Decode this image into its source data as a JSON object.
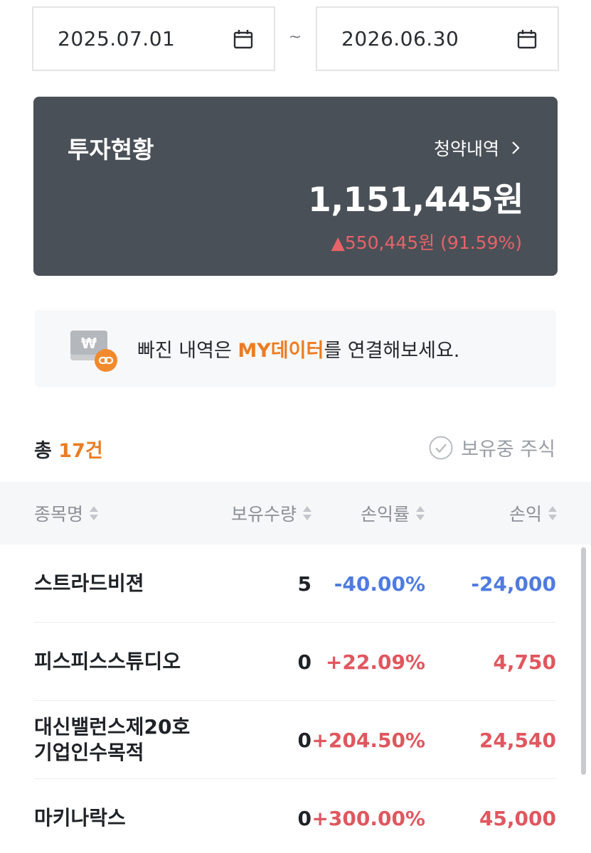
{
  "date_range": {
    "start": "2025.07.01",
    "separator": "~",
    "end": "2026.06.30",
    "icon": "calendar-icon"
  },
  "summary": {
    "title": "투자현황",
    "link_label": "청약내역",
    "total": "1,151,445원",
    "change": "▲550,445원 (91.59%)"
  },
  "banner": {
    "icon": "wallet-link-icon",
    "text_before": "빠진 내역은 ",
    "highlight": "MY데이터",
    "text_after": "를 연결해보세요."
  },
  "list": {
    "count_prefix": "총 ",
    "count": "17건",
    "holding_filter_label": "보유중 주식"
  },
  "table": {
    "columns": [
      "종목명",
      "보유수량",
      "손익률",
      "손익"
    ],
    "rows": [
      {
        "name": "스트라드비젼",
        "qty": "5",
        "rate": "-40.00%",
        "pnl": "-24,000",
        "trend": "neg"
      },
      {
        "name": "피스피스스튜디오",
        "qty": "0",
        "rate": "+22.09%",
        "pnl": "4,750",
        "trend": "pos"
      },
      {
        "name": "대신밸런스제20호\n기업인수목적",
        "qty": "0",
        "rate": "+204.50%",
        "pnl": "24,540",
        "trend": "pos"
      },
      {
        "name": "마키나락스",
        "qty": "0",
        "rate": "+300.00%",
        "pnl": "45,000",
        "trend": "pos"
      }
    ]
  },
  "colors": {
    "accent_orange": "#ec7c22",
    "positive_red": "#e0575f",
    "negative_blue": "#4f7be0",
    "card_bg": "#4a5057"
  }
}
